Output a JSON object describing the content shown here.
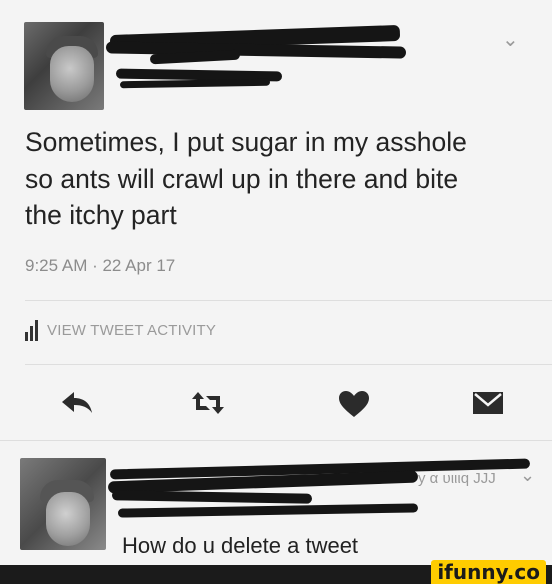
{
  "tweet": {
    "text": "Sometimes, I put sugar in my asshole\nso ants will crawl up in there and bite\nthe itchy part",
    "timestamp": "9:25 AM · 22 Apr 17",
    "activity_label": "VIEW TWEET ACTIVITY",
    "author_name_redacted": true
  },
  "actions": {
    "reply_icon": "reply-icon",
    "retweet_icon": "retweet-icon",
    "like_icon": "heart-icon",
    "dm_icon": "envelope-icon",
    "icon_color": "#2b2b2b"
  },
  "reply": {
    "handle_fragment": "y α υιιιq JJJ",
    "text": "How do u delete a tweet"
  },
  "watermark": {
    "label": "ifunny.co",
    "bg_color": "#ffcc00"
  }
}
